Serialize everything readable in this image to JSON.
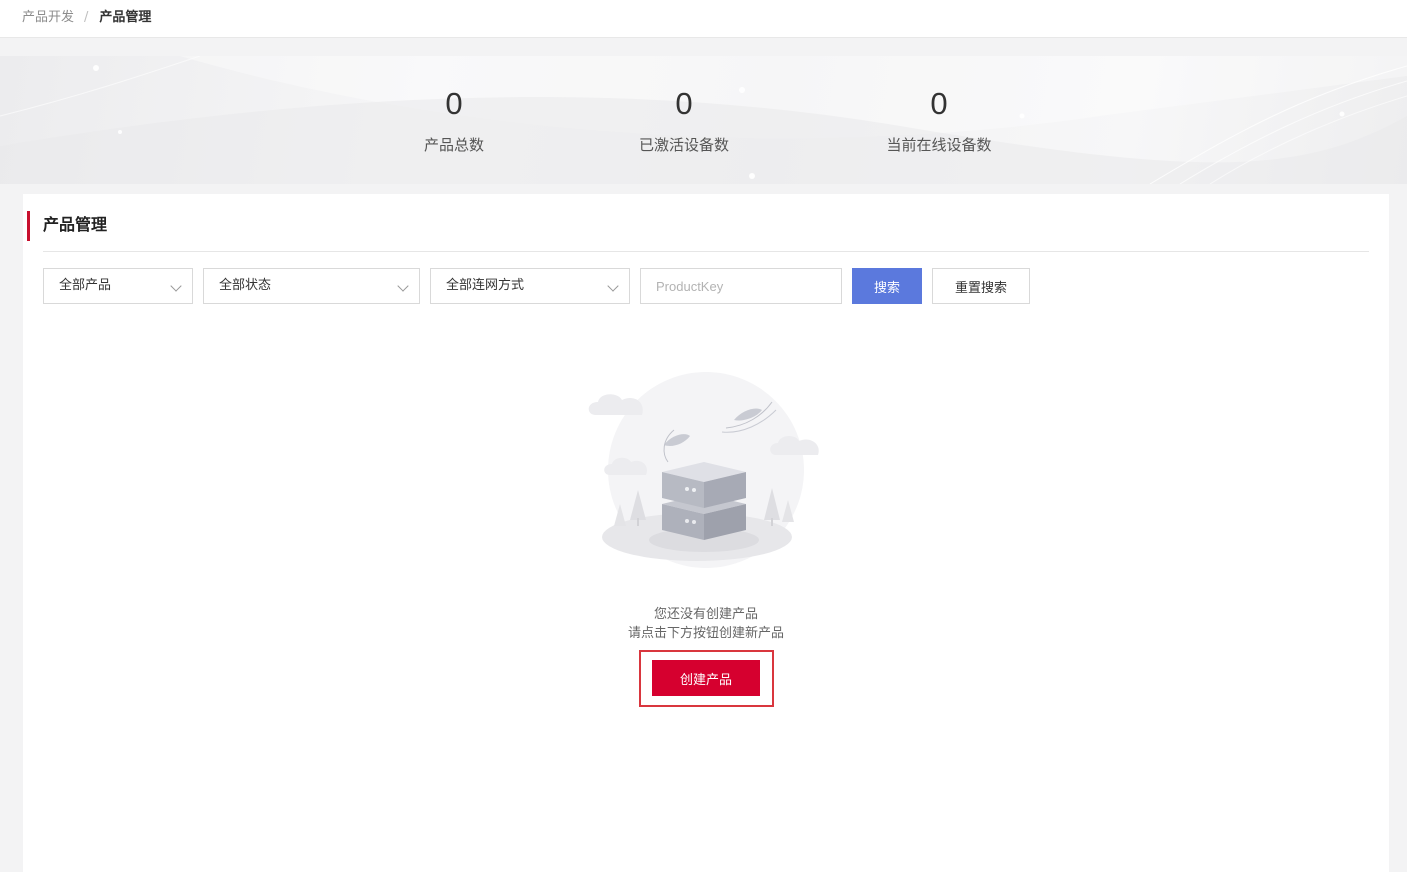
{
  "breadcrumb": {
    "parent": "产品开发",
    "separator": "/",
    "current": "产品管理"
  },
  "stats": [
    {
      "value": "0",
      "label": "产品总数"
    },
    {
      "value": "0",
      "label": "已激活设备数"
    },
    {
      "value": "0",
      "label": "当前在线设备数"
    }
  ],
  "panel": {
    "title": "产品管理"
  },
  "filters": {
    "product_select": "全部产品",
    "status_select": "全部状态",
    "network_select": "全部连网方式",
    "productkey_placeholder": "ProductKey",
    "search_label": "搜索",
    "reset_label": "重置搜索"
  },
  "empty": {
    "line1": "您还没有创建产品",
    "line2": "请点击下方按钮创建新产品",
    "create_label": "创建产品",
    "illustration_icon": "server-stack-icon"
  },
  "colors": {
    "accent_red": "#d6002f",
    "title_bar": "#c8102e",
    "search_blue": "#5b79dd",
    "highlight_border": "#d9363e"
  }
}
